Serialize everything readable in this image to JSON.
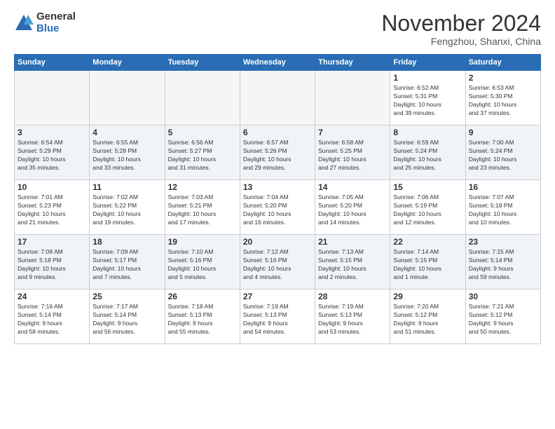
{
  "logo": {
    "general": "General",
    "blue": "Blue"
  },
  "title": "November 2024",
  "location": "Fengzhou, Shanxi, China",
  "days_of_week": [
    "Sunday",
    "Monday",
    "Tuesday",
    "Wednesday",
    "Thursday",
    "Friday",
    "Saturday"
  ],
  "weeks": [
    [
      {
        "day": "",
        "content": "",
        "empty": true
      },
      {
        "day": "",
        "content": "",
        "empty": true
      },
      {
        "day": "",
        "content": "",
        "empty": true
      },
      {
        "day": "",
        "content": "",
        "empty": true
      },
      {
        "day": "",
        "content": "",
        "empty": true
      },
      {
        "day": "1",
        "content": "Sunrise: 6:52 AM\nSunset: 5:31 PM\nDaylight: 10 hours\nand 39 minutes."
      },
      {
        "day": "2",
        "content": "Sunrise: 6:53 AM\nSunset: 5:30 PM\nDaylight: 10 hours\nand 37 minutes."
      }
    ],
    [
      {
        "day": "3",
        "content": "Sunrise: 6:54 AM\nSunset: 5:29 PM\nDaylight: 10 hours\nand 35 minutes."
      },
      {
        "day": "4",
        "content": "Sunrise: 6:55 AM\nSunset: 5:28 PM\nDaylight: 10 hours\nand 33 minutes."
      },
      {
        "day": "5",
        "content": "Sunrise: 6:56 AM\nSunset: 5:27 PM\nDaylight: 10 hours\nand 31 minutes."
      },
      {
        "day": "6",
        "content": "Sunrise: 6:57 AM\nSunset: 5:26 PM\nDaylight: 10 hours\nand 29 minutes."
      },
      {
        "day": "7",
        "content": "Sunrise: 6:58 AM\nSunset: 5:25 PM\nDaylight: 10 hours\nand 27 minutes."
      },
      {
        "day": "8",
        "content": "Sunrise: 6:59 AM\nSunset: 5:24 PM\nDaylight: 10 hours\nand 25 minutes."
      },
      {
        "day": "9",
        "content": "Sunrise: 7:00 AM\nSunset: 5:24 PM\nDaylight: 10 hours\nand 23 minutes."
      }
    ],
    [
      {
        "day": "10",
        "content": "Sunrise: 7:01 AM\nSunset: 5:23 PM\nDaylight: 10 hours\nand 21 minutes."
      },
      {
        "day": "11",
        "content": "Sunrise: 7:02 AM\nSunset: 5:22 PM\nDaylight: 10 hours\nand 19 minutes."
      },
      {
        "day": "12",
        "content": "Sunrise: 7:03 AM\nSunset: 5:21 PM\nDaylight: 10 hours\nand 17 minutes."
      },
      {
        "day": "13",
        "content": "Sunrise: 7:04 AM\nSunset: 5:20 PM\nDaylight: 10 hours\nand 16 minutes."
      },
      {
        "day": "14",
        "content": "Sunrise: 7:05 AM\nSunset: 5:20 PM\nDaylight: 10 hours\nand 14 minutes."
      },
      {
        "day": "15",
        "content": "Sunrise: 7:06 AM\nSunset: 5:19 PM\nDaylight: 10 hours\nand 12 minutes."
      },
      {
        "day": "16",
        "content": "Sunrise: 7:07 AM\nSunset: 5:18 PM\nDaylight: 10 hours\nand 10 minutes."
      }
    ],
    [
      {
        "day": "17",
        "content": "Sunrise: 7:08 AM\nSunset: 5:18 PM\nDaylight: 10 hours\nand 9 minutes."
      },
      {
        "day": "18",
        "content": "Sunrise: 7:09 AM\nSunset: 5:17 PM\nDaylight: 10 hours\nand 7 minutes."
      },
      {
        "day": "19",
        "content": "Sunrise: 7:10 AM\nSunset: 5:16 PM\nDaylight: 10 hours\nand 5 minutes."
      },
      {
        "day": "20",
        "content": "Sunrise: 7:12 AM\nSunset: 5:16 PM\nDaylight: 10 hours\nand 4 minutes."
      },
      {
        "day": "21",
        "content": "Sunrise: 7:13 AM\nSunset: 5:15 PM\nDaylight: 10 hours\nand 2 minutes."
      },
      {
        "day": "22",
        "content": "Sunrise: 7:14 AM\nSunset: 5:15 PM\nDaylight: 10 hours\nand 1 minute."
      },
      {
        "day": "23",
        "content": "Sunrise: 7:15 AM\nSunset: 5:14 PM\nDaylight: 9 hours\nand 59 minutes."
      }
    ],
    [
      {
        "day": "24",
        "content": "Sunrise: 7:16 AM\nSunset: 5:14 PM\nDaylight: 9 hours\nand 58 minutes."
      },
      {
        "day": "25",
        "content": "Sunrise: 7:17 AM\nSunset: 5:14 PM\nDaylight: 9 hours\nand 56 minutes."
      },
      {
        "day": "26",
        "content": "Sunrise: 7:18 AM\nSunset: 5:13 PM\nDaylight: 9 hours\nand 55 minutes."
      },
      {
        "day": "27",
        "content": "Sunrise: 7:19 AM\nSunset: 5:13 PM\nDaylight: 9 hours\nand 54 minutes."
      },
      {
        "day": "28",
        "content": "Sunrise: 7:19 AM\nSunset: 5:13 PM\nDaylight: 9 hours\nand 53 minutes."
      },
      {
        "day": "29",
        "content": "Sunrise: 7:20 AM\nSunset: 5:12 PM\nDaylight: 9 hours\nand 51 minutes."
      },
      {
        "day": "30",
        "content": "Sunrise: 7:21 AM\nSunset: 5:12 PM\nDaylight: 9 hours\nand 50 minutes."
      }
    ]
  ]
}
